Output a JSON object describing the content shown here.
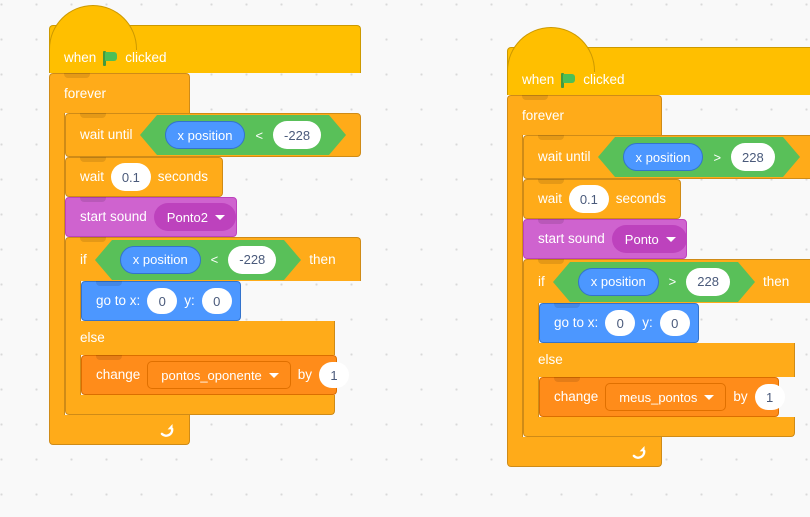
{
  "workspace": {
    "background_color": "#f9f9f9",
    "grid_dot_color": "#d9d9d9",
    "grid_spacing_px": 35
  },
  "palette": {
    "events_yellow": "#ffbf00",
    "control_orange": "#ffab19",
    "sound_magenta": "#cf63cf",
    "motion_blue": "#4c97ff",
    "variables_orange": "#ff8c1a",
    "operators_green": "#59c059",
    "input_white": "#ffffff",
    "input_text": "#4a5a7b"
  },
  "scripts": [
    {
      "id": "script-opponent",
      "hat": {
        "when_label": "when",
        "flag_icon": "green-flag-icon",
        "clicked_label": "clicked"
      },
      "forever": {
        "label": "forever",
        "loop_icon": "loop-arrow-icon"
      },
      "wait_until": {
        "label": "wait until",
        "condition": {
          "left_reporter": "x position",
          "operator": "<",
          "right_value": "-228"
        }
      },
      "wait": {
        "label_before": "wait",
        "value": "0.1",
        "label_after": "seconds"
      },
      "start_sound": {
        "label": "start sound",
        "sound_name": "Ponto2",
        "caret_icon": "chevron-down-icon"
      },
      "if_else": {
        "if_label": "if",
        "then_label": "then",
        "else_label": "else",
        "condition": {
          "left_reporter": "x position",
          "operator": "<",
          "right_value": "-228"
        },
        "then_branch": {
          "go_to": {
            "label_x": "go to x:",
            "x_value": "0",
            "label_y": "y:",
            "y_value": "0"
          }
        },
        "else_branch": {
          "change_var": {
            "change_label": "change",
            "variable_name": "pontos_oponente",
            "caret_icon": "chevron-down-icon",
            "by_label": "by",
            "by_value": "1"
          }
        }
      }
    },
    {
      "id": "script-player",
      "hat": {
        "when_label": "when",
        "flag_icon": "green-flag-icon",
        "clicked_label": "clicked"
      },
      "forever": {
        "label": "forever",
        "loop_icon": "loop-arrow-icon"
      },
      "wait_until": {
        "label": "wait until",
        "condition": {
          "left_reporter": "x position",
          "operator": ">",
          "right_value": "228"
        }
      },
      "wait": {
        "label_before": "wait",
        "value": "0.1",
        "label_after": "seconds"
      },
      "start_sound": {
        "label": "start sound",
        "sound_name": "Ponto",
        "caret_icon": "chevron-down-icon"
      },
      "if_else": {
        "if_label": "if",
        "then_label": "then",
        "else_label": "else",
        "condition": {
          "left_reporter": "x position",
          "operator": ">",
          "right_value": "228"
        },
        "then_branch": {
          "go_to": {
            "label_x": "go to x:",
            "x_value": "0",
            "label_y": "y:",
            "y_value": "0"
          }
        },
        "else_branch": {
          "change_var": {
            "change_label": "change",
            "variable_name": "meus_pontos",
            "caret_icon": "chevron-down-icon",
            "by_label": "by",
            "by_value": "1"
          }
        }
      }
    }
  ]
}
